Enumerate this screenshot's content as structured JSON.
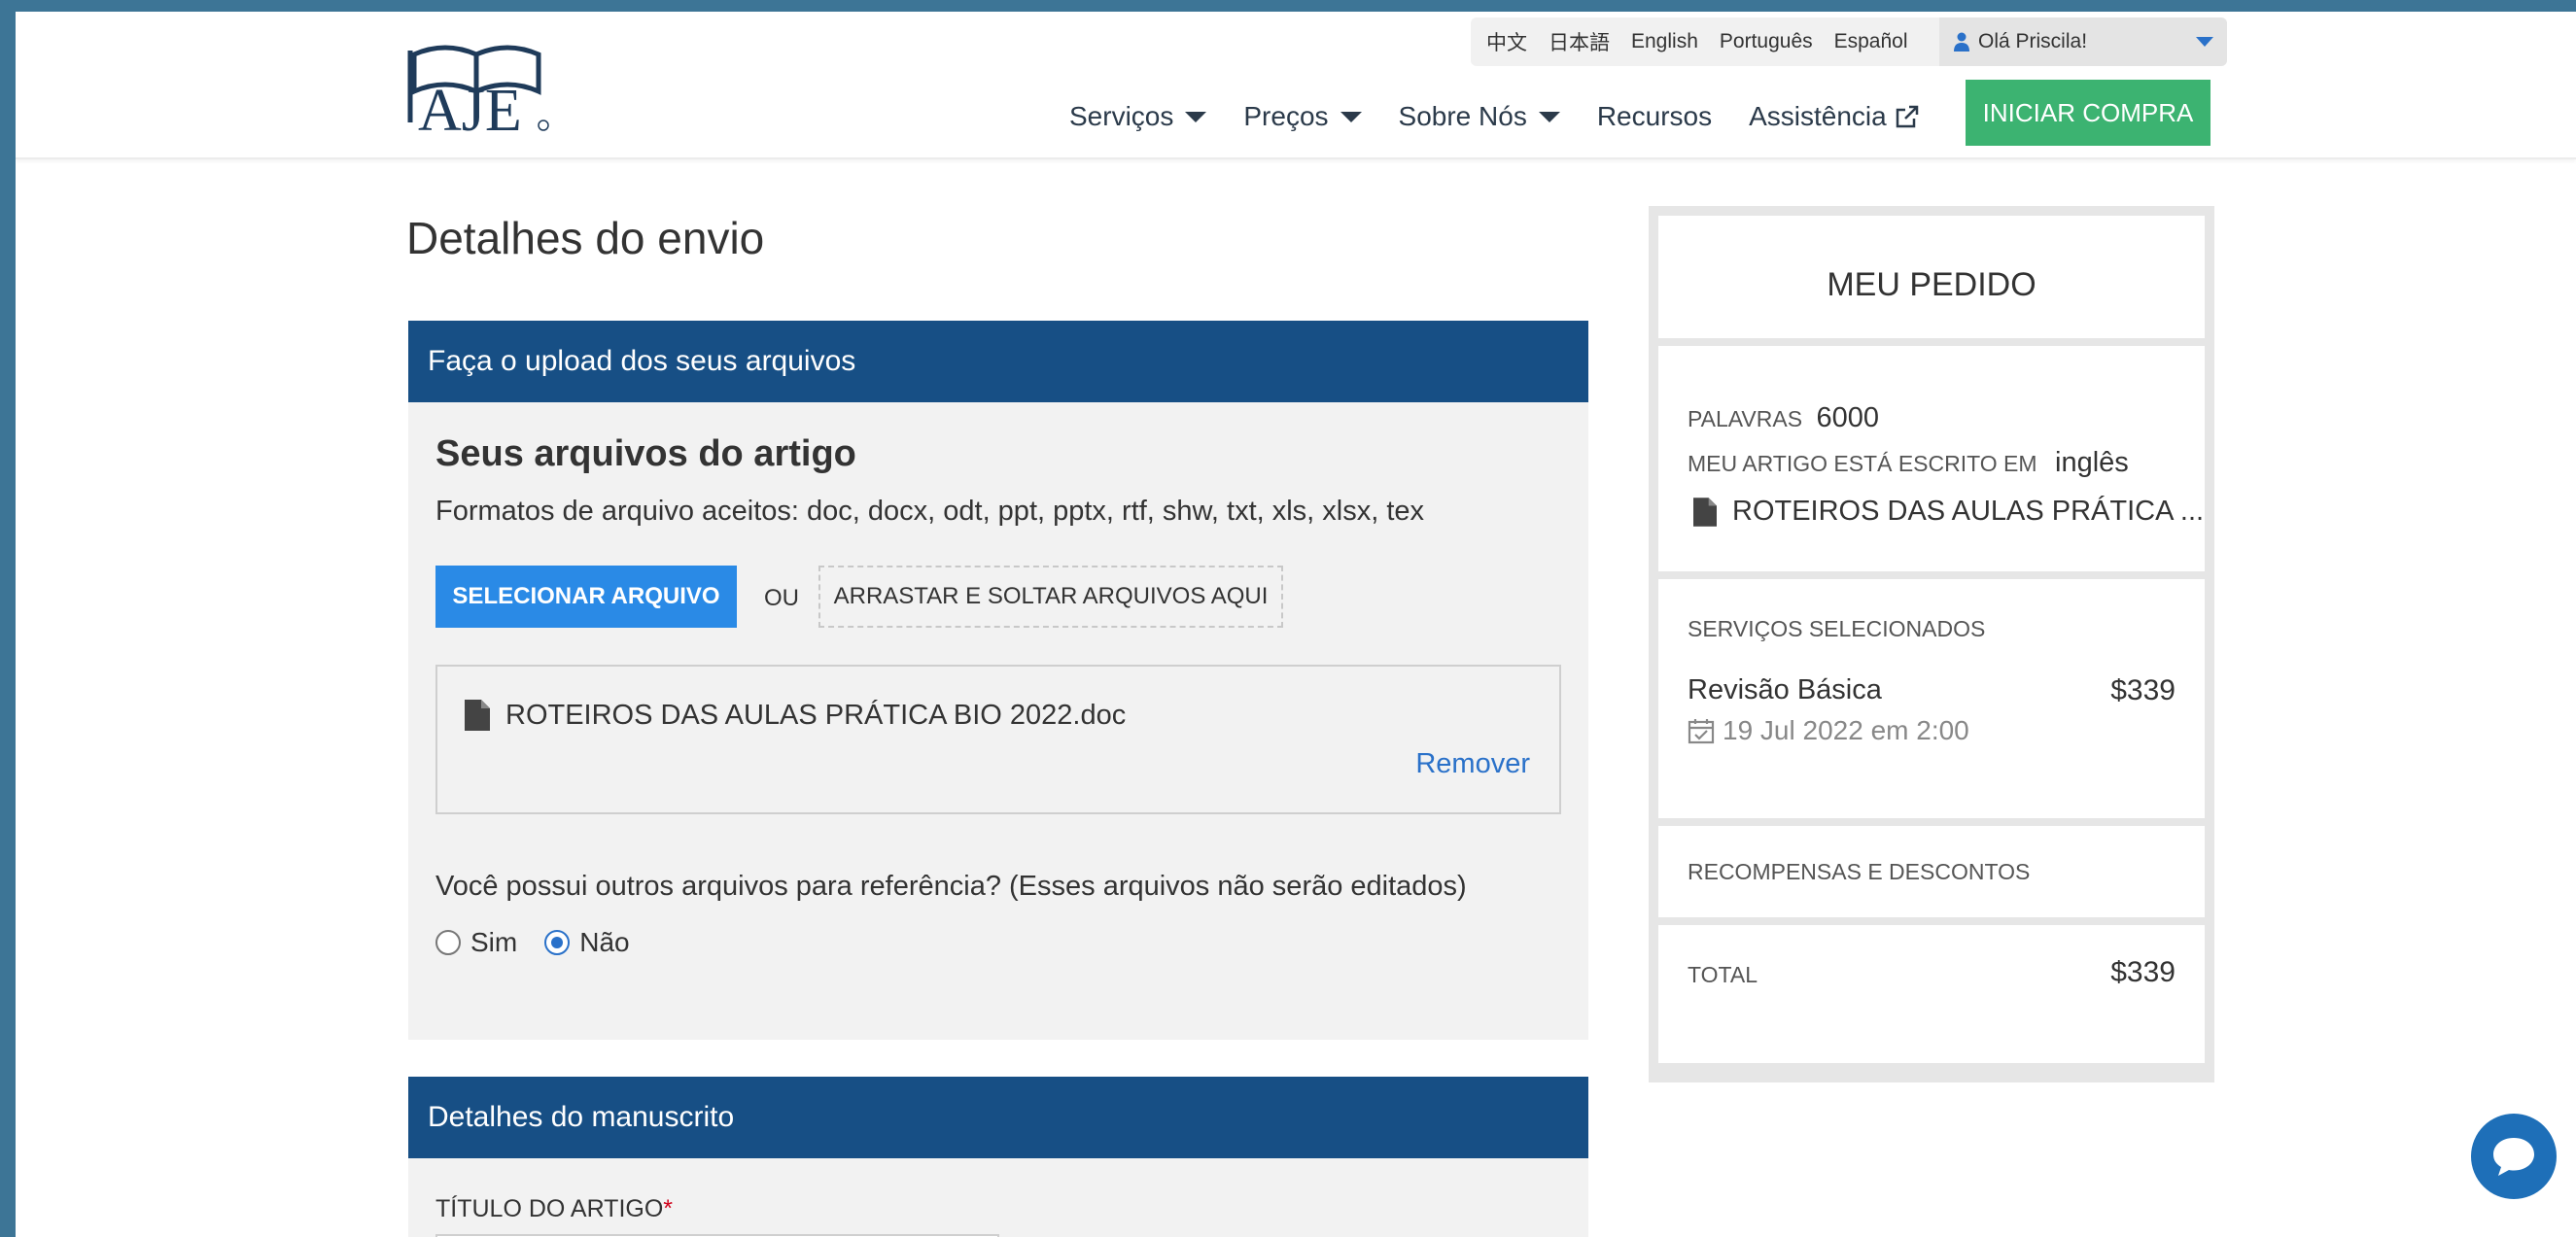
{
  "header": {
    "logo_text": "AJE",
    "languages": [
      "中文",
      "日本語",
      "English",
      "Português",
      "Español"
    ],
    "user_greeting": "Olá Priscila!",
    "nav": [
      {
        "label": "Serviços",
        "dropdown": true
      },
      {
        "label": "Preços",
        "dropdown": true
      },
      {
        "label": "Sobre Nós",
        "dropdown": true
      },
      {
        "label": "Recursos",
        "dropdown": false
      },
      {
        "label": "Assistência",
        "dropdown": false,
        "external": true
      }
    ],
    "cta_label": "INICIAR COMPRA"
  },
  "main": {
    "page_title": "Detalhes do envio",
    "upload_section": {
      "header": "Faça o upload dos seus arquivos",
      "subtitle": "Seus arquivos do artigo",
      "formats": "Formatos de arquivo aceitos: doc, docx, odt, ppt, pptx, rtf, shw, txt, xls, xlsx, tex",
      "select_button": "SELECIONAR ARQUIVO",
      "or_text": "OU",
      "drop_zone": "ARRASTAR E SOLTAR ARQUIVOS AQUI",
      "file_name": "ROTEIROS DAS AULAS PRÁTICA BIO 2022.doc",
      "remove_label": "Remover",
      "question": "Você possui outros arquivos para referência? (Esses arquivos não serão editados)",
      "option_yes": "Sim",
      "option_no": "Não",
      "selected": "Não"
    },
    "manuscript_section": {
      "header": "Detalhes do manuscrito",
      "title_label": "TÍTULO DO ARTIGO",
      "required_mark": "*"
    }
  },
  "sidebar": {
    "title": "MEU PEDIDO",
    "words_label": "PALAVRAS",
    "words_value": "6000",
    "language_label": "MEU ARTIGO ESTÁ ESCRITO EM",
    "language_value": "inglês",
    "file_name": "ROTEIROS DAS AULAS PRÁTICA ...",
    "services_label": "SERVIÇOS SELECIONADOS",
    "service_name": "Revisão Básica",
    "service_price": "$339",
    "service_date": "19 Jul 2022 em 2:00",
    "rewards_label": "RECOMPENSAS E DESCONTOS",
    "total_label": "TOTAL",
    "total_value": "$339"
  },
  "colors": {
    "primary_blue": "#174f85",
    "button_blue": "#2a8ae6",
    "cta_green": "#3cb371",
    "link_blue": "#2a71c9"
  }
}
